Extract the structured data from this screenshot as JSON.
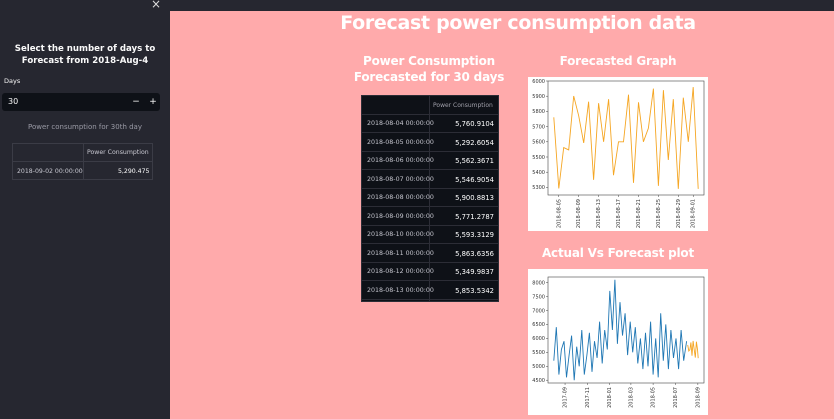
{
  "sidebar": {
    "close_glyph": "×",
    "title": "Select the number of days to Forecast from 2018-Aug-4",
    "days_label": "Days",
    "days_value": "30",
    "minus_label": "−",
    "plus_label": "+",
    "subtitle": "Power consumption for 30th day",
    "table": {
      "column_header": "Power Consumption",
      "row_date": "2018-09-02 00:00:00",
      "row_value": "5,290.475"
    }
  },
  "main": {
    "title": "Forecast power consumption data",
    "table_heading_line1": "Power Consumption",
    "table_heading_line2": "Forecasted for 30 days",
    "table": {
      "column_header": "Power Consumption",
      "rows": [
        {
          "date": "2018-08-04 00:00:00",
          "value": "5,760.9104"
        },
        {
          "date": "2018-08-05 00:00:00",
          "value": "5,292.6054"
        },
        {
          "date": "2018-08-06 00:00:00",
          "value": "5,562.3671"
        },
        {
          "date": "2018-08-07 00:00:00",
          "value": "5,546.9054"
        },
        {
          "date": "2018-08-08 00:00:00",
          "value": "5,900.8813"
        },
        {
          "date": "2018-08-09 00:00:00",
          "value": "5,771.2787"
        },
        {
          "date": "2018-08-10 00:00:00",
          "value": "5,593.3129"
        },
        {
          "date": "2018-08-11 00:00:00",
          "value": "5,863.6356"
        },
        {
          "date": "2018-08-12 00:00:00",
          "value": "5,349.9837"
        },
        {
          "date": "2018-08-13 00:00:00",
          "value": "5,853.5342"
        }
      ]
    },
    "forecast_heading": "Forecasted Graph",
    "actual_heading": "Actual Vs Forecast plot"
  },
  "chart_data": [
    {
      "type": "line",
      "title": "Forecasted Graph",
      "color": "#f5a623",
      "ylim": [
        5250,
        6000
      ],
      "yticks": [
        "5300",
        "5400",
        "5500",
        "5600",
        "5700",
        "5800",
        "5900",
        "6000"
      ],
      "xticks": [
        "2018-08-05",
        "2018-08-09",
        "2018-08-13",
        "2018-08-17",
        "2018-08-21",
        "2018-08-25",
        "2018-08-29",
        "2018-09-01"
      ],
      "x": [
        "2018-08-04",
        "2018-08-05",
        "2018-08-06",
        "2018-08-07",
        "2018-08-08",
        "2018-08-09",
        "2018-08-10",
        "2018-08-11",
        "2018-08-12",
        "2018-08-13",
        "2018-08-14",
        "2018-08-15",
        "2018-08-16",
        "2018-08-17",
        "2018-08-18",
        "2018-08-19",
        "2018-08-20",
        "2018-08-21",
        "2018-08-22",
        "2018-08-23",
        "2018-08-24",
        "2018-08-25",
        "2018-08-26",
        "2018-08-27",
        "2018-08-28",
        "2018-08-29",
        "2018-08-30",
        "2018-08-31",
        "2018-09-01",
        "2018-09-02"
      ],
      "values": [
        5761,
        5293,
        5562,
        5547,
        5901,
        5771,
        5593,
        5864,
        5350,
        5854,
        5600,
        5880,
        5380,
        5600,
        5600,
        5910,
        5330,
        5860,
        5600,
        5690,
        5950,
        5310,
        5940,
        5480,
        5880,
        5290,
        5890,
        5600,
        5960,
        5290
      ]
    },
    {
      "type": "line",
      "title": "Actual Vs Forecast plot",
      "ylim": [
        4400,
        8200
      ],
      "yticks": [
        "4500",
        "5000",
        "5500",
        "6000",
        "6500",
        "7000",
        "7500",
        "8000"
      ],
      "xticks": [
        "2017-09",
        "2017-11",
        "2018-01",
        "2018-03",
        "2018-05",
        "2018-07",
        "2018-09"
      ],
      "series": [
        {
          "color": "#1f77b4",
          "x": [
            "2017-08-01",
            "2017-08-08",
            "2017-08-15",
            "2017-08-22",
            "2017-08-29",
            "2017-09-05",
            "2017-09-12",
            "2017-09-19",
            "2017-09-26",
            "2017-10-03",
            "2017-10-10",
            "2017-10-17",
            "2017-10-24",
            "2017-10-31",
            "2017-11-07",
            "2017-11-14",
            "2017-11-21",
            "2017-11-28",
            "2017-12-05",
            "2017-12-12",
            "2017-12-19",
            "2017-12-26",
            "2018-01-02",
            "2018-01-09",
            "2018-01-16",
            "2018-01-23",
            "2018-01-30",
            "2018-02-06",
            "2018-02-13",
            "2018-02-20",
            "2018-02-27",
            "2018-03-06",
            "2018-03-13",
            "2018-03-20",
            "2018-03-27",
            "2018-04-03",
            "2018-04-10",
            "2018-04-17",
            "2018-04-24",
            "2018-05-01",
            "2018-05-08",
            "2018-05-15",
            "2018-05-22",
            "2018-05-29",
            "2018-06-05",
            "2018-06-12",
            "2018-06-19",
            "2018-06-26",
            "2018-07-03",
            "2018-07-10",
            "2018-07-17",
            "2018-07-24",
            "2018-08-01"
          ],
          "values": [
            5200,
            6400,
            4700,
            5600,
            5900,
            4600,
            5400,
            6100,
            4500,
            5700,
            5000,
            6300,
            4700,
            5400,
            6200,
            4800,
            5900,
            5300,
            6600,
            5100,
            6300,
            5600,
            7700,
            6300,
            8100,
            5800,
            7300,
            6100,
            6900,
            5400,
            6600,
            5500,
            6400,
            5100,
            6000,
            4900,
            6200,
            5000,
            6600,
            4700,
            6000,
            4600,
            6900,
            5200,
            6500,
            4900,
            6300,
            5300,
            6000,
            4900,
            6300,
            5200,
            5900
          ]
        },
        {
          "color": "#f5a623",
          "x": [
            "2018-08-04",
            "2018-08-07",
            "2018-08-10",
            "2018-08-13",
            "2018-08-16",
            "2018-08-19",
            "2018-08-22",
            "2018-08-25",
            "2018-08-28",
            "2018-08-31",
            "2018-09-02"
          ],
          "values": [
            5761,
            5547,
            5593,
            5854,
            5380,
            5910,
            5600,
            5310,
            5880,
            5600,
            5290
          ]
        }
      ]
    }
  ]
}
